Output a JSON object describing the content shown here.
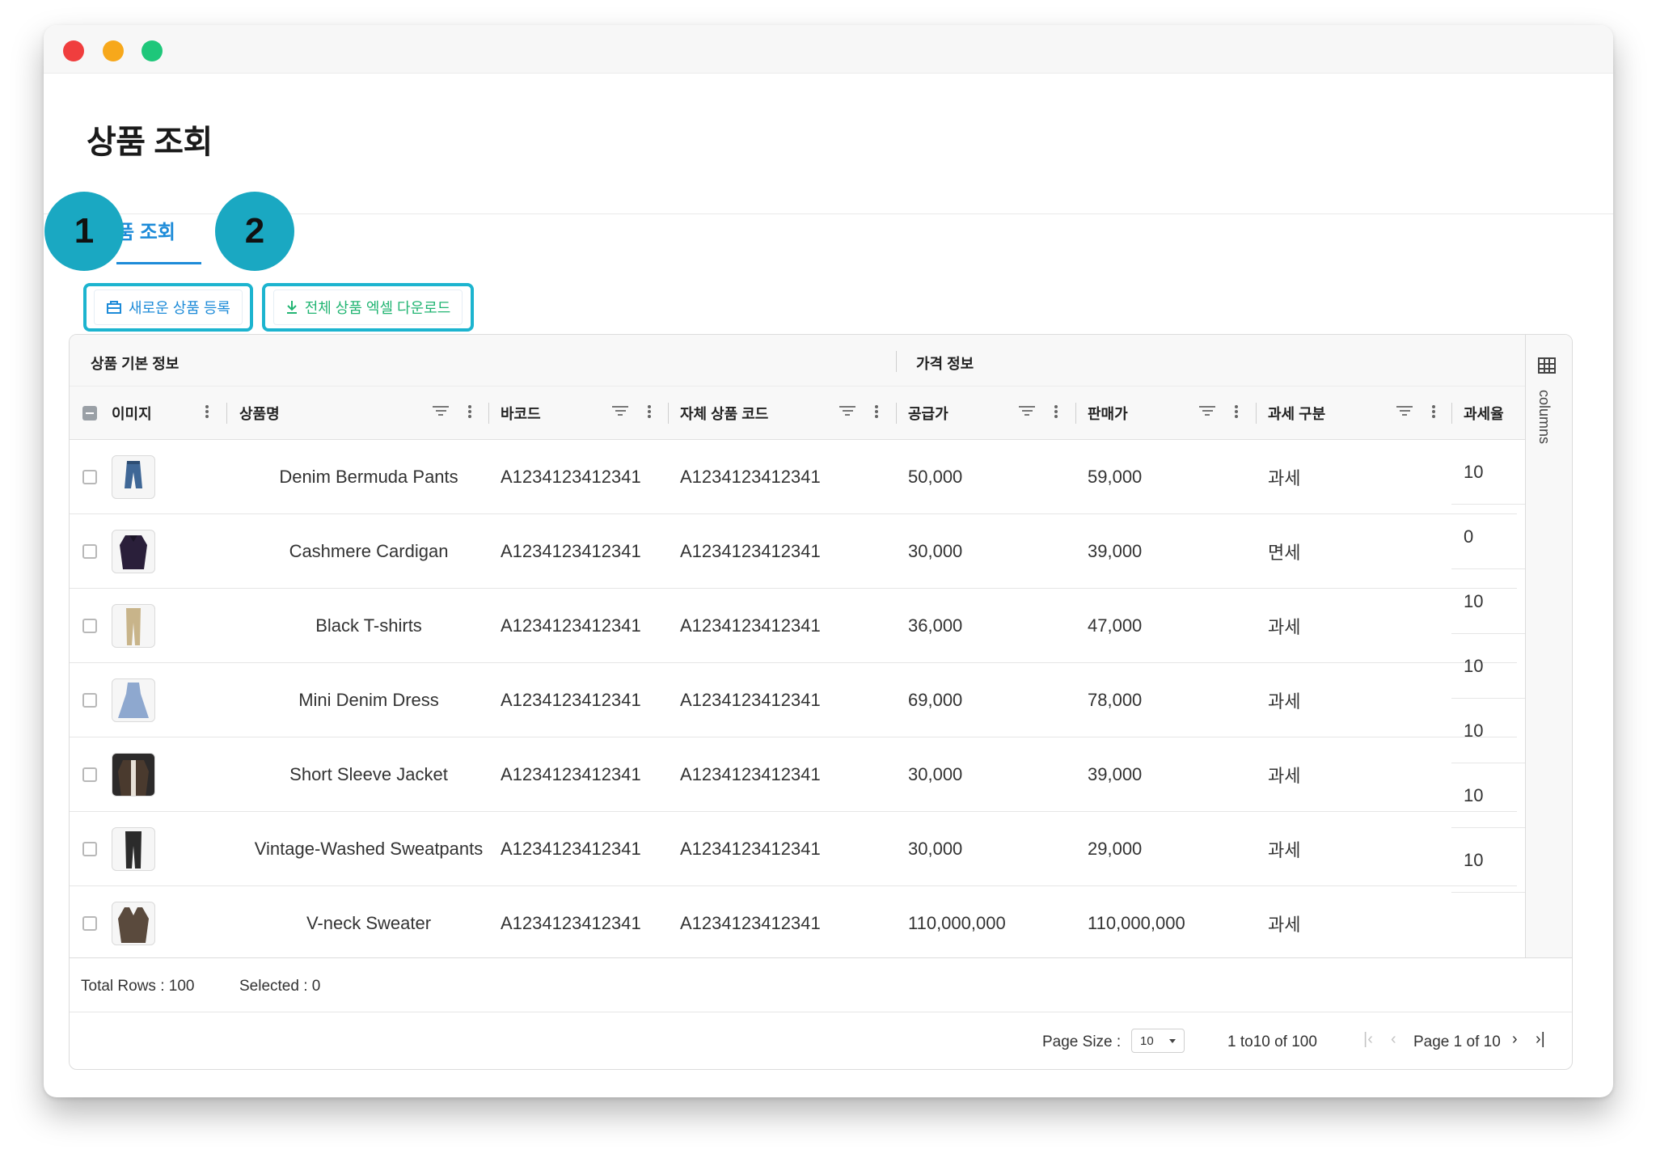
{
  "page": {
    "title": "상품 조회"
  },
  "tabs": [
    {
      "label": "상품 조회",
      "visible_label": "품 조회",
      "active": true
    }
  ],
  "actions": {
    "new_product": {
      "label": "새로운 상품 등록",
      "icon": "box-icon"
    },
    "download_all": {
      "label": "전체 상품 엑셀 다운로드",
      "icon": "download-icon"
    }
  },
  "badges": [
    "1",
    "2"
  ],
  "grid": {
    "groups": [
      {
        "label": "상품 기본 정보"
      },
      {
        "label": "가격 정보"
      }
    ],
    "columns": [
      {
        "label": "이미지"
      },
      {
        "label": "상품명"
      },
      {
        "label": "바코드"
      },
      {
        "label": "자체 상품 코드"
      },
      {
        "label": "공급가"
      },
      {
        "label": "판매가"
      },
      {
        "label": "과세 구분"
      },
      {
        "label": "과세율"
      }
    ],
    "rows": [
      {
        "name": "Denim Bermuda Pants",
        "barcode": "A1234123412341",
        "code": "A1234123412341",
        "supply": "50,000",
        "price": "59,000",
        "tax_type": "과세",
        "tax_rate": "10"
      },
      {
        "name": "Cashmere Cardigan",
        "barcode": "A1234123412341",
        "code": "A1234123412341",
        "supply": "30,000",
        "price": "39,000",
        "tax_type": "면세",
        "tax_rate": "0"
      },
      {
        "name": "Black T-shirts",
        "barcode": "A1234123412341",
        "code": "A1234123412341",
        "supply": "36,000",
        "price": "47,000",
        "tax_type": "과세",
        "tax_rate": "10"
      },
      {
        "name": "Mini Denim Dress",
        "barcode": "A1234123412341",
        "code": "A1234123412341",
        "supply": "69,000",
        "price": "78,000",
        "tax_type": "과세",
        "tax_rate": "10"
      },
      {
        "name": "Short Sleeve Jacket",
        "barcode": "A1234123412341",
        "code": "A1234123412341",
        "supply": "30,000",
        "price": "39,000",
        "tax_type": "과세",
        "tax_rate": "10"
      },
      {
        "name": "Vintage-Washed Sweatpants",
        "barcode": "A1234123412341",
        "code": "A1234123412341",
        "supply": "30,000",
        "price": "29,000",
        "tax_type": "과세",
        "tax_rate": "10"
      },
      {
        "name": "V-neck Sweater",
        "barcode": "A1234123412341",
        "code": "A1234123412341",
        "supply": "110,000,000",
        "price": "110,000,000",
        "tax_type": "과세",
        "tax_rate": "10"
      }
    ],
    "side_panel_label": "columns"
  },
  "footer": {
    "total_rows": "Total Rows : 100",
    "selected": "Selected : 0",
    "page_size_label": "Page Size :",
    "page_size_value": "10",
    "range": "1 to10 of 100",
    "page_indicator": "Page 1 of 10"
  },
  "colors": {
    "accent_blue": "#1d8bd8",
    "accent_green": "#22b573",
    "badge_teal": "#1aa8c2",
    "highlight_border": "#1cb4cf"
  }
}
